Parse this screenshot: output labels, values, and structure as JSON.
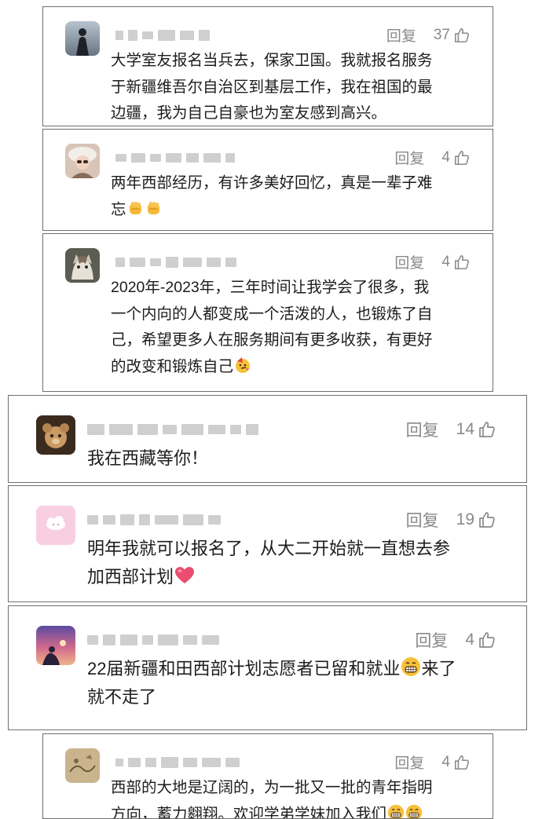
{
  "comments": [
    {
      "avatar_icon": "avatar-silhouette-sky",
      "username": "",
      "reply_label": "回复",
      "like_count": "37",
      "lines": [
        "大学室友报名当兵去，保家卫国。我就报名服务",
        "于新疆维吾尔自治区到基层工作，我在祖国的最",
        "边疆，我为自己自豪也为室友感到高兴。"
      ],
      "emoji": []
    },
    {
      "avatar_icon": "avatar-girl-hat",
      "username": "",
      "reply_label": "回复",
      "like_count": "4",
      "lines": [
        "两年西部经历，有许多美好回忆，真是一辈子难",
        "忘"
      ],
      "emoji": [
        "fist-emoji",
        "fist-emoji"
      ]
    },
    {
      "avatar_icon": "avatar-cat",
      "username": "",
      "reply_label": "回复",
      "like_count": "4",
      "lines": [
        "2020年-2023年，三年时间让我学会了很多，我",
        "一个内向的人都变成一个活泼的人，也锻炼了自",
        "己，希望更多人在服务期间有更多收获，有更好",
        "的改变和锻炼自己"
      ],
      "emoji": [
        "party-face-emoji"
      ]
    },
    {
      "avatar_icon": "avatar-teddy-bear",
      "username": "",
      "reply_label": "回复",
      "like_count": "14",
      "lines": [
        "我在西藏等你！"
      ],
      "emoji": []
    },
    {
      "avatar_icon": "avatar-pink-cloud",
      "username": "",
      "reply_label": "回复",
      "like_count": "19",
      "lines": [
        "明年我就可以报名了，从大二开始就一直想去参",
        "加西部计划"
      ],
      "emoji": [
        "heart-emoji"
      ]
    },
    {
      "avatar_icon": "avatar-sunset",
      "username": "",
      "reply_label": "回复",
      "like_count": "4",
      "lines": [
        "22届新疆和田西部计划志愿者已留和就业",
        "来了",
        "就不走了"
      ],
      "emoji": [
        "grin-emoji"
      ]
    },
    {
      "avatar_icon": "avatar-sketch",
      "username": "",
      "reply_label": "回复",
      "like_count": "4",
      "lines": [
        "西部的大地是辽阔的，为一批又一批的青年指明",
        "方向，蓄力翱翔。欢迎学弟学妹加入我们"
      ],
      "emoji": [
        "grin-emoji",
        "grin-emoji"
      ]
    }
  ],
  "colors": {
    "border": "#6f6f6f",
    "meta_text": "#8a8a8a",
    "body_text": "#1c1c1c",
    "blur": "#cfcfcf"
  }
}
